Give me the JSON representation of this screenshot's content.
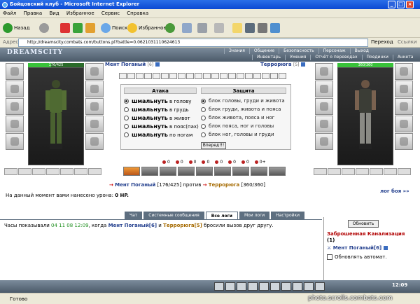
{
  "window": {
    "title": "Бойцовский клуб - Microsoft Internet Explorer"
  },
  "menu": [
    "Файл",
    "Правка",
    "Вид",
    "Избранное",
    "Сервис",
    "Справка"
  ],
  "toolbar": {
    "back": "Назад",
    "search": "Поиск",
    "favorites": "Избранное"
  },
  "address": {
    "label": "Адрес:",
    "url": "http://dreamscity.combats.com/buttons.pl?battle=0.0621031110624613",
    "go": "Переход",
    "links": "Ссылки"
  },
  "game": {
    "logo": "DREAMSCITY",
    "nav_top": [
      "Знания",
      "Общение",
      "Безопасность",
      "Персонаж",
      "Выход"
    ],
    "nav_bottom": [
      "Инвентарь",
      "Умения",
      "Отчёт о переводах",
      "Поединки",
      "Анкета"
    ],
    "left_player": {
      "name": "Мент Поганый",
      "level": "[6]",
      "hp": "176/425",
      "hp_fraction": 0.414
    },
    "right_player": {
      "name": "Террорюга",
      "level": "[5]",
      "hp": "360/360",
      "hp_fraction": 1.0
    },
    "attack": {
      "header": "Атака",
      "verb": "шмальнуть",
      "options": [
        "в голову",
        "в грудь",
        "в живот",
        "в пояс(пах)",
        "по ногам"
      ]
    },
    "defense": {
      "header": "Защита",
      "options": [
        "блок головы, груди и живота",
        "блок груди, живота и пояса",
        "блок живота, пояса и ног",
        "блок пояса, ног и головы",
        "блок ног, головы и груди"
      ]
    },
    "go_button": "Вперед!!!",
    "counters": [
      "0",
      "0",
      "0",
      "0",
      "0",
      "0",
      "0",
      "0+"
    ],
    "versus": {
      "arrow": "→",
      "me": "Мент Поганый",
      "me_hp": "[176/425]",
      "word": "против",
      "op": "Террорюга",
      "op_hp": "[360/360]"
    },
    "damage": {
      "text": "На данный момент вами нанесено урона:",
      "value": "0 HP."
    },
    "battle_log": "лог боя »»",
    "chat_tabs": [
      "Чат",
      "Системные сообщения",
      "Все логи",
      "Мои логи",
      "Настройки"
    ],
    "chat_message": {
      "prefix": "Часы показывали",
      "time": "04 11 08 12:09",
      "mid": ", когда",
      "me": "Мент Поганый[6]",
      "and": "и",
      "op": "Террорюга[5]",
      "suffix": "бросили вызов друг другу."
    },
    "side": {
      "refresh": "Обновить",
      "location": "Заброшенная Канализация",
      "count": "(1)",
      "player": "Мент Поганый[6]",
      "auto_refresh": "Обновлять автомат."
    },
    "clock": "12:09"
  },
  "status": {
    "text": "Готово",
    "watermark": "photo.scrolls.combats.com"
  },
  "colors": {
    "title_bar": "#0b49d3",
    "game_header": "#4b5a69",
    "player_link": "#24408e",
    "opponent_link": "#a56a00",
    "location": "#b10000"
  }
}
